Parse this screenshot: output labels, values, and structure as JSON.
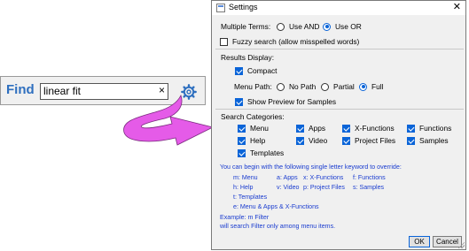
{
  "find": {
    "label": "Find",
    "value": "linear fit",
    "clear_glyph": "×",
    "settings_icon": "gear-icon"
  },
  "window": {
    "title": "Settings",
    "close_glyph": "✕"
  },
  "multiple_terms": {
    "label": "Multiple Terms:",
    "options": [
      "Use AND",
      "Use OR"
    ],
    "selected": "Use OR"
  },
  "fuzzy": {
    "label": "Fuzzy search (allow misspelled words)",
    "checked": false
  },
  "results_display": {
    "label": "Results Display:",
    "compact": {
      "label": "Compact",
      "checked": true
    },
    "menu_path": {
      "label": "Menu Path:",
      "options": [
        "No Path",
        "Partial",
        "Full"
      ],
      "selected": "Full"
    },
    "show_preview": {
      "label": "Show Preview for Samples",
      "checked": true
    }
  },
  "search_categories": {
    "label": "Search Categories:",
    "items": [
      {
        "label": "Menu",
        "checked": true
      },
      {
        "label": "Apps",
        "checked": true
      },
      {
        "label": "X-Functions",
        "checked": true
      },
      {
        "label": "Functions",
        "checked": true
      },
      {
        "label": "Help",
        "checked": true
      },
      {
        "label": "Video",
        "checked": true
      },
      {
        "label": "Project Files",
        "checked": true
      },
      {
        "label": "Samples",
        "checked": true
      },
      {
        "label": "Templates",
        "checked": true
      }
    ]
  },
  "help": {
    "intro": "You can begin with the following single letter keyword to override:",
    "row1": [
      "m: Menu",
      "a: Apps",
      "x: X-Functions",
      "f: Functions"
    ],
    "row2": [
      "h: Help",
      "v: Video",
      "p: Project Files",
      "s: Samples"
    ],
    "row3": "t: Templates",
    "row4": "e: Menu & Apps & X-Functions",
    "example1": "Example: m Filter",
    "example2": "will search Filter only among menu items."
  },
  "buttons": {
    "ok": "OK",
    "cancel": "Cancel"
  },
  "colors": {
    "accent": "#0a64d8",
    "find_label": "#2e6fbf",
    "arrow": "#e55be8",
    "help_text": "#1a3ccf"
  }
}
